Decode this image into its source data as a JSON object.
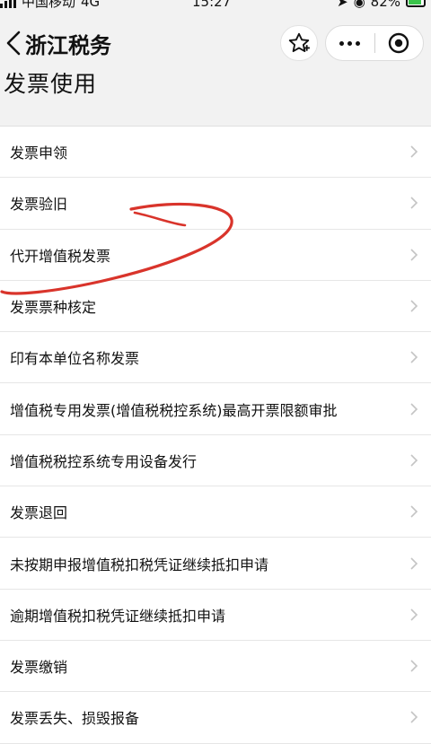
{
  "status_bar": {
    "carrier": "中国移动",
    "network": "4G",
    "time": "15:27",
    "battery": "82%"
  },
  "nav": {
    "title": "浙江税务"
  },
  "page": {
    "title": "发票使用"
  },
  "menu": {
    "items": [
      {
        "label": "发票申领"
      },
      {
        "label": "发票验旧"
      },
      {
        "label": "代开增值税发票"
      },
      {
        "label": "发票票种核定"
      },
      {
        "label": "印有本单位名称发票"
      },
      {
        "label": "增值税专用发票(增值税税控系统)最高开票限额审批"
      },
      {
        "label": "增值税税控系统专用设备发行"
      },
      {
        "label": "发票退回"
      },
      {
        "label": "未按期申报增值税扣税凭证继续抵扣申请"
      },
      {
        "label": "逾期增值税扣税凭证继续抵扣申请"
      },
      {
        "label": "发票缴销"
      },
      {
        "label": "发票丢失、损毁报备"
      }
    ]
  },
  "colors": {
    "annotation": "#d9342b",
    "chevron": "#c4c4c4",
    "battery_fill": "#3bc44b"
  },
  "icons": [
    "signal-icon",
    "location-icon",
    "battery-icon",
    "back-chevron-icon",
    "star-icon",
    "more-icon",
    "target-icon",
    "chevron-right-icon"
  ]
}
